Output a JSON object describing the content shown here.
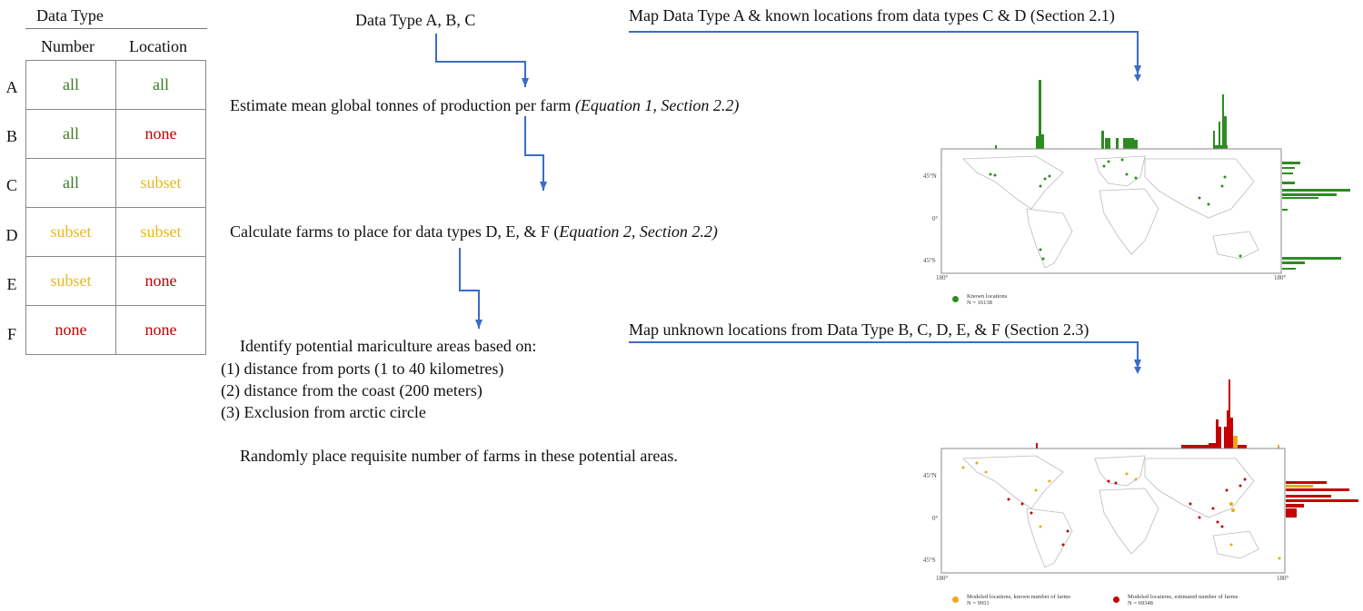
{
  "table": {
    "header": "Data Type",
    "columns": [
      "Number",
      "Location"
    ],
    "rows": [
      {
        "label": "A",
        "number": "all",
        "location": "all"
      },
      {
        "label": "B",
        "number": "all",
        "location": "none"
      },
      {
        "label": "C",
        "number": "all",
        "location": "subset"
      },
      {
        "label": "D",
        "number": "subset",
        "location": "subset"
      },
      {
        "label": "E",
        "number": "subset",
        "location": "none"
      },
      {
        "label": "F",
        "number": "none",
        "location": "none"
      }
    ],
    "value_colors": {
      "all": "#3a7d1e",
      "subset": "#e8b81e",
      "none": "#c00000"
    }
  },
  "flow": {
    "step1": "Data Type A, B, C",
    "step2_main": "Estimate mean global tonnes of production per farm ",
    "step2_ref": "(Equation 1, Section 2.2)",
    "step3_main": "Calculate farms to place for data types D, E, & F (",
    "step3_ref": "Equation 2, Section 2.2)",
    "step4_title": "Identify potential mariculture areas based on:",
    "step4_items": [
      "(1)  distance from ports (1 to 40 kilometres)",
      "(2)  distance from the coast (200 meters)",
      "(3)  Exclusion from arctic circle"
    ],
    "step5": "Randomly place requisite number of farms in these potential areas.",
    "map1_title": "Map Data Type A & known locations from data types C & D  (Section 2.1)",
    "map2_title": "Map unknown locations from Data Type B, C, D, E, & F (Section 2.3)",
    "arrow_color": "#3b6cc4"
  },
  "map1": {
    "y_ticks": [
      "45°N",
      "0°",
      "45°S"
    ],
    "x_ticks": [
      "180°",
      "180°"
    ],
    "legend": [
      {
        "label": "Known locations",
        "n": "N = 16138",
        "color": "#2e8b22"
      }
    ]
  },
  "map2": {
    "y_ticks": [
      "45°N",
      "0°",
      "45°S"
    ],
    "x_ticks": [
      "180°",
      "180°"
    ],
    "legend": [
      {
        "label": "Modeled locations, known number of farms",
        "n": "N = 9951",
        "color": "#f0a818"
      },
      {
        "label": "Modeled locations, estimated number of farms",
        "n": "N = 69348",
        "color": "#c40000"
      }
    ]
  }
}
